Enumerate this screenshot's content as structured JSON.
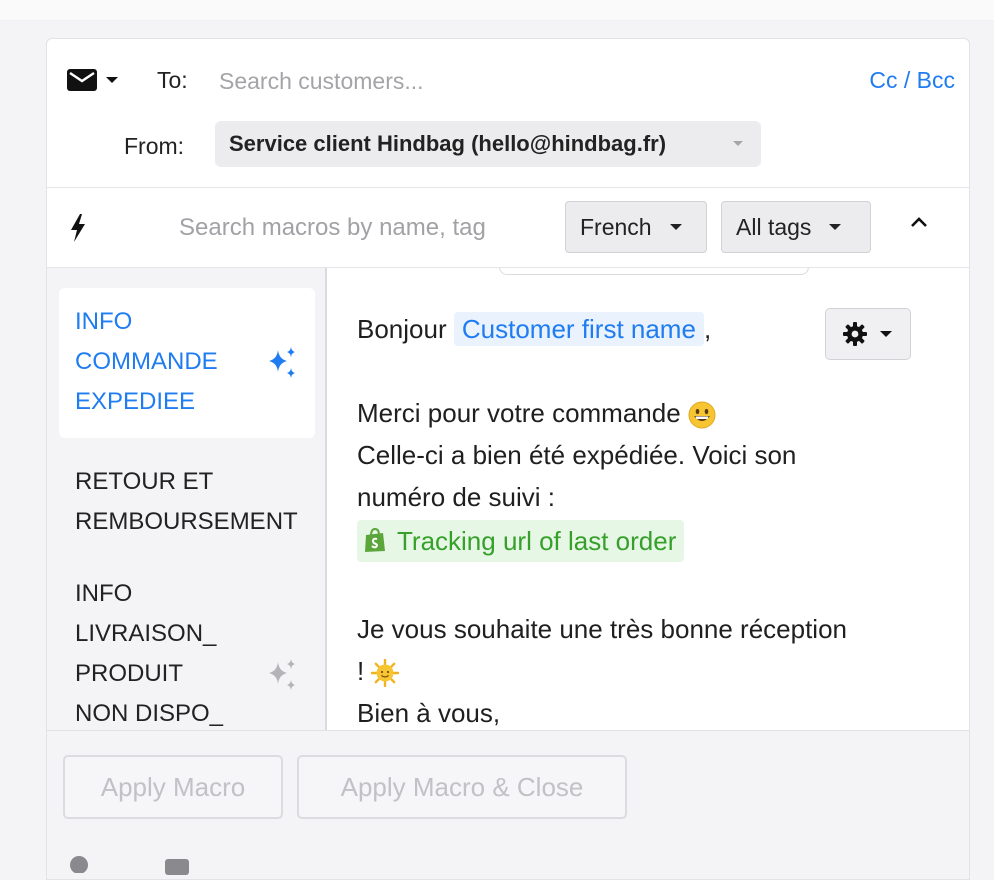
{
  "header": {
    "to_label": "To:",
    "to_placeholder": "Search customers...",
    "cc_bcc": "Cc / Bcc",
    "from_label": "From:",
    "from_value": "Service client Hindbag (hello@hindbag.fr)"
  },
  "macro_toolbar": {
    "search_placeholder": "Search macros by name, tag",
    "language": "French",
    "tags": "All tags"
  },
  "macros": [
    {
      "lines": [
        "INFO",
        "COMMANDE",
        "EXPEDIEE"
      ],
      "active": true
    },
    {
      "lines": [
        "RETOUR ET",
        "REMBOURSEMENT"
      ],
      "active": false
    },
    {
      "lines": [
        "INFO",
        "LIVRAISON_",
        "PRODUIT",
        "NON DISPO_"
      ],
      "active": false
    }
  ],
  "preview": {
    "greeting": "Bonjour",
    "var_first_name": "Customer first name",
    "comma": ",",
    "line1": "Merci pour votre commande",
    "line2": "Celle-ci a bien été expédiée. Voici son",
    "line3": "numéro de suivi :",
    "var_tracking": "Tracking url of last order",
    "line4": "Je vous souhaite une très bonne réception",
    "line5": "!",
    "line6": "Bien à vous,"
  },
  "footer": {
    "apply": "Apply Macro",
    "apply_close": "Apply Macro & Close"
  },
  "colors": {
    "accent_blue": "#1f7cf1",
    "green": "#36a02b"
  }
}
